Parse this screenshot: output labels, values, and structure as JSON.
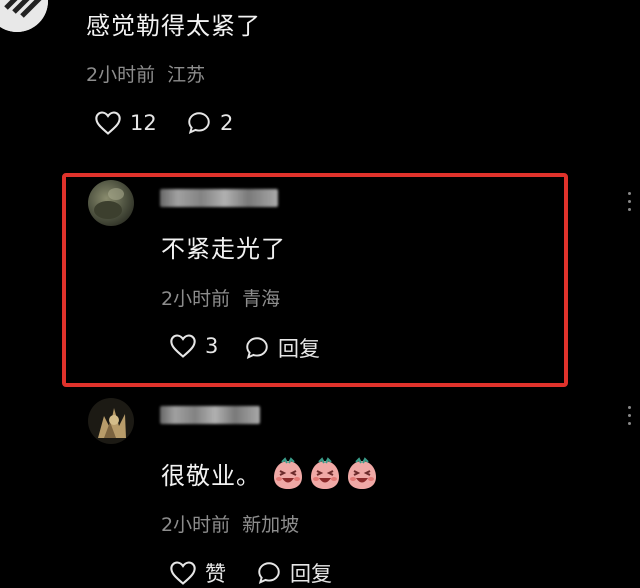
{
  "comments": [
    {
      "text": "感觉勒得太紧了",
      "time": "2小时前",
      "location": "江苏",
      "likes": "12",
      "replies": "2"
    },
    {
      "text": "不紧走光了",
      "time": "2小时前",
      "location": "青海",
      "likes": "3",
      "reply_label": "回复"
    },
    {
      "text": "很敬业。",
      "emoji_count": 3,
      "time": "2小时前",
      "location": "新加坡",
      "likes": "赞",
      "reply_label": "回复"
    }
  ],
  "icons": [
    "heart-icon",
    "comment-bubble-icon",
    "more-dots-icon"
  ],
  "colors": {
    "background": "#000000",
    "text": "#f2f2f2",
    "meta": "#8d8d8d",
    "highlight": "#e0322b"
  }
}
